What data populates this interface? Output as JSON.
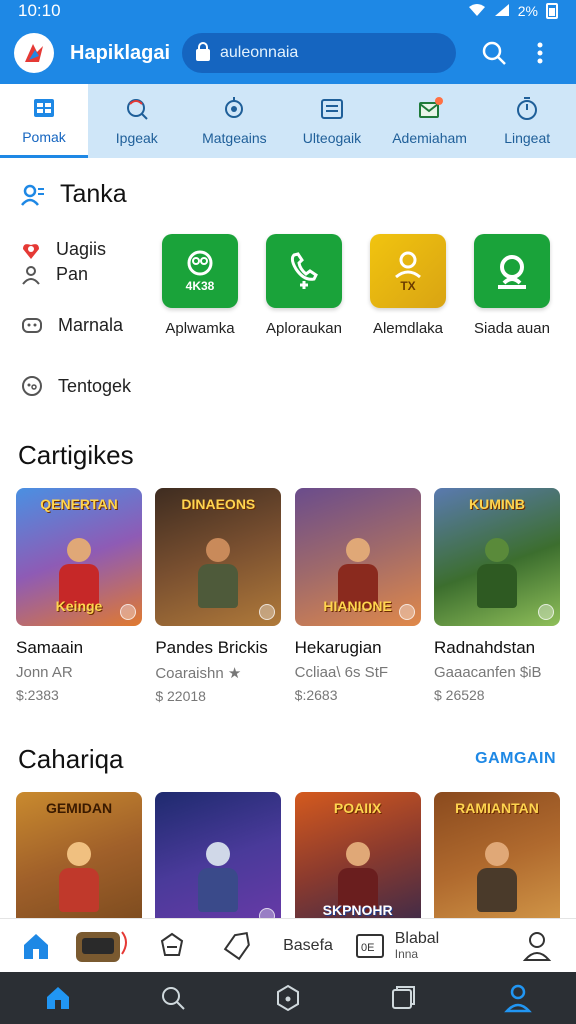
{
  "status_bar": {
    "time": "10:10",
    "battery_text": "2%"
  },
  "app_bar": {
    "title": "Hapiklagai",
    "search_value": "auleonnaia",
    "search_icon": "search-icon",
    "menu_icon": "more-vertical-icon",
    "colors": {
      "primary": "#1e88e5",
      "search_bg": "#1565c0"
    }
  },
  "tabs": [
    {
      "label": "Pomak",
      "icon": "grid-icon",
      "active": true
    },
    {
      "label": "Ipgeak",
      "icon": "search-circle-icon",
      "active": false
    },
    {
      "label": "Matgeains",
      "icon": "target-icon",
      "active": false
    },
    {
      "label": "Ulteogaik",
      "icon": "list-icon",
      "active": false
    },
    {
      "label": "Ademiaham",
      "icon": "mail-icon",
      "active": false
    },
    {
      "label": "Lingeat",
      "icon": "timer-icon",
      "active": false
    }
  ],
  "tanka": {
    "title": "Tanka",
    "side_items": [
      {
        "line1": "Uagiis",
        "line2": "Pan"
      },
      {
        "line1": "Marnala"
      },
      {
        "line1": "Tentogek"
      }
    ],
    "apps": [
      {
        "name": "Aplwamka",
        "badge": "4K38",
        "color": "#1aa33a"
      },
      {
        "name": "Aploraukan",
        "badge": "",
        "color": "#1aa33a"
      },
      {
        "name": "Alemdlaka",
        "badge": "TX",
        "color": "#e6b51a"
      },
      {
        "name": "Siada auan",
        "badge": "",
        "color": "#1aa33a"
      }
    ]
  },
  "cartigikes": {
    "title": "Cartigikes",
    "games": [
      {
        "banner": "QENERTAN",
        "banner2": "Keinge",
        "title": "Samaain",
        "sub": "Jonn AR",
        "price": "$:2383",
        "bg": [
          "#4a90e2",
          "#e07a2f"
        ]
      },
      {
        "banner": "DINAEONS",
        "banner2": "",
        "title": "Pandes Brickis",
        "sub": "Coaraishn ★",
        "price": "$ 22018",
        "bg": [
          "#3e2c20",
          "#b07a3a"
        ]
      },
      {
        "banner": "",
        "banner2": "HIANIONE",
        "title": "Hekarugian",
        "sub": "Ccliaa\\ 6s StF",
        "price": "$:2683",
        "bg": [
          "#6a4c8c",
          "#e0894a"
        ]
      },
      {
        "banner": "KUMINB",
        "banner2": "",
        "title": "Radnahdstan",
        "sub": "Gaaacanfen $iB",
        "price": "$ 26528",
        "bg": [
          "#3c6e2e",
          "#8fbf5a"
        ]
      }
    ]
  },
  "cahariqa": {
    "title": "Cahariqa",
    "see_all": "GAMGAIN",
    "games": [
      {
        "banner": "GEMIDAN",
        "bg": [
          "#c98a2e",
          "#7a4a1e"
        ]
      },
      {
        "banner": "",
        "bg": [
          "#1e2a6e",
          "#6a3aa8"
        ]
      },
      {
        "banner": "POAIIX",
        "banner2": "SKPNOHR",
        "bg": [
          "#d45a1e",
          "#3a2a4a"
        ]
      },
      {
        "banner": "RAMIANTAN",
        "bg": [
          "#8a4a1e",
          "#d49a4a"
        ]
      }
    ]
  },
  "content_nav": {
    "item_label": "Basefa",
    "item_label2": "Blabal",
    "item_sub2": "Inna"
  }
}
